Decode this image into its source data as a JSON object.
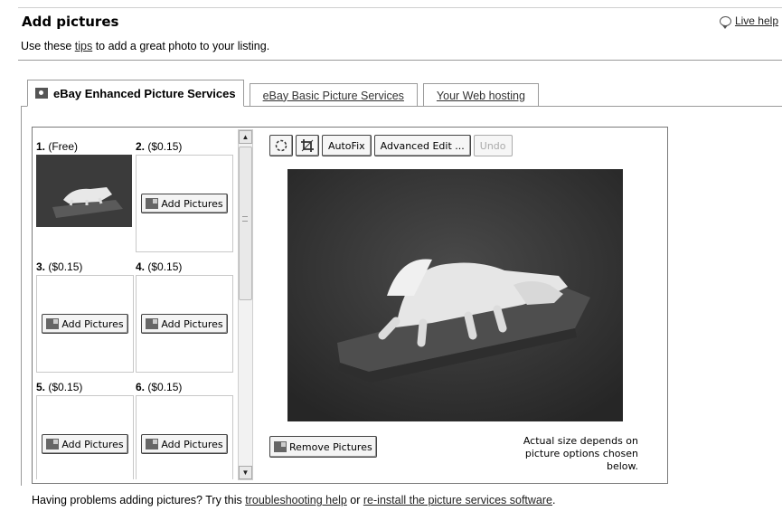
{
  "header": {
    "title": "Add pictures",
    "live_help": "Live help"
  },
  "tips_line": {
    "prefix": "Use these ",
    "link": "tips",
    "suffix": " to add a great photo to your listing."
  },
  "tabs": [
    {
      "label": "eBay Enhanced Picture Services",
      "active": true
    },
    {
      "label": "eBay Basic Picture Services",
      "active": false
    },
    {
      "label": "Your Web hosting",
      "active": false
    }
  ],
  "slots": [
    {
      "num": "1.",
      "price": "(Free)",
      "has_picture": true
    },
    {
      "num": "2.",
      "price": "($0.15)",
      "button": "Add Pictures"
    },
    {
      "num": "3.",
      "price": "($0.15)",
      "button": "Add Pictures"
    },
    {
      "num": "4.",
      "price": "($0.15)",
      "button": "Add Pictures"
    },
    {
      "num": "5.",
      "price": "($0.15)",
      "button": "Add Pictures"
    },
    {
      "num": "6.",
      "price": "($0.15)",
      "button": "Add Pictures"
    }
  ],
  "toolbar": {
    "rotate_icon": "rotate-icon",
    "crop_icon": "crop-icon",
    "autofix": "AutoFix",
    "advanced_edit": "Advanced Edit ...",
    "undo": "Undo"
  },
  "preview": {
    "remove_button": "Remove Pictures",
    "size_note_line1": "Actual size depends on",
    "size_note_line2": "picture options chosen below."
  },
  "footer": {
    "prefix": "Having problems adding pictures? Try this ",
    "link1": "troubleshooting help",
    "middle": " or ",
    "link2": "re-install the picture services software",
    "suffix": "."
  }
}
